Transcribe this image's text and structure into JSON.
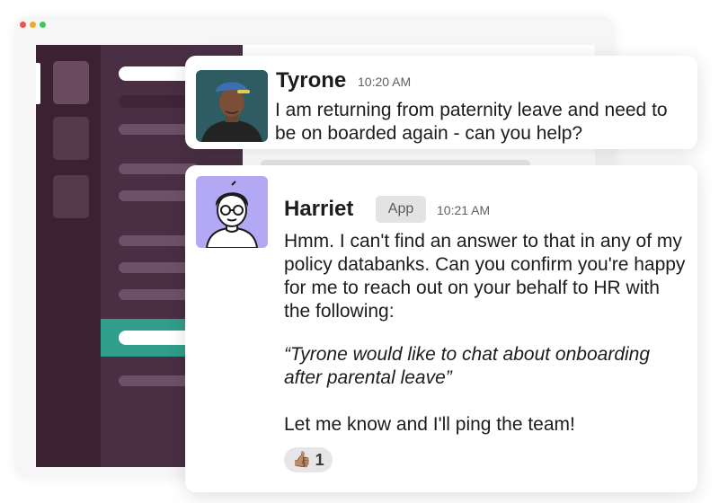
{
  "window": {
    "traffic_lights": [
      "#ef5350",
      "#f5a623",
      "#43c463"
    ]
  },
  "colors": {
    "rail": "#3b2132",
    "sidebar": "#4a2f44",
    "selected_channel": "#2f9e8a"
  },
  "messages": [
    {
      "author": "Tyrone",
      "time": "10:20 AM",
      "text": "I am returning from paternity leave and need to be on boarded again - can you help?",
      "avatar_icon": "user-photo-avatar"
    },
    {
      "author": "Harriet",
      "badge": "App",
      "time": "10:21 AM",
      "text": "Hmm. I can't find an answer to that in any of my policy databanks. Can you confirm you're happy for me to reach out on your behalf to HR with the following:",
      "quote": "“Tyrone would like to chat about onboarding after parental leave”",
      "closing": "Let me know and I'll ping the team!",
      "avatar_icon": "bot-avatar",
      "reaction": {
        "emoji": "👍🏽",
        "count": "1"
      }
    }
  ]
}
